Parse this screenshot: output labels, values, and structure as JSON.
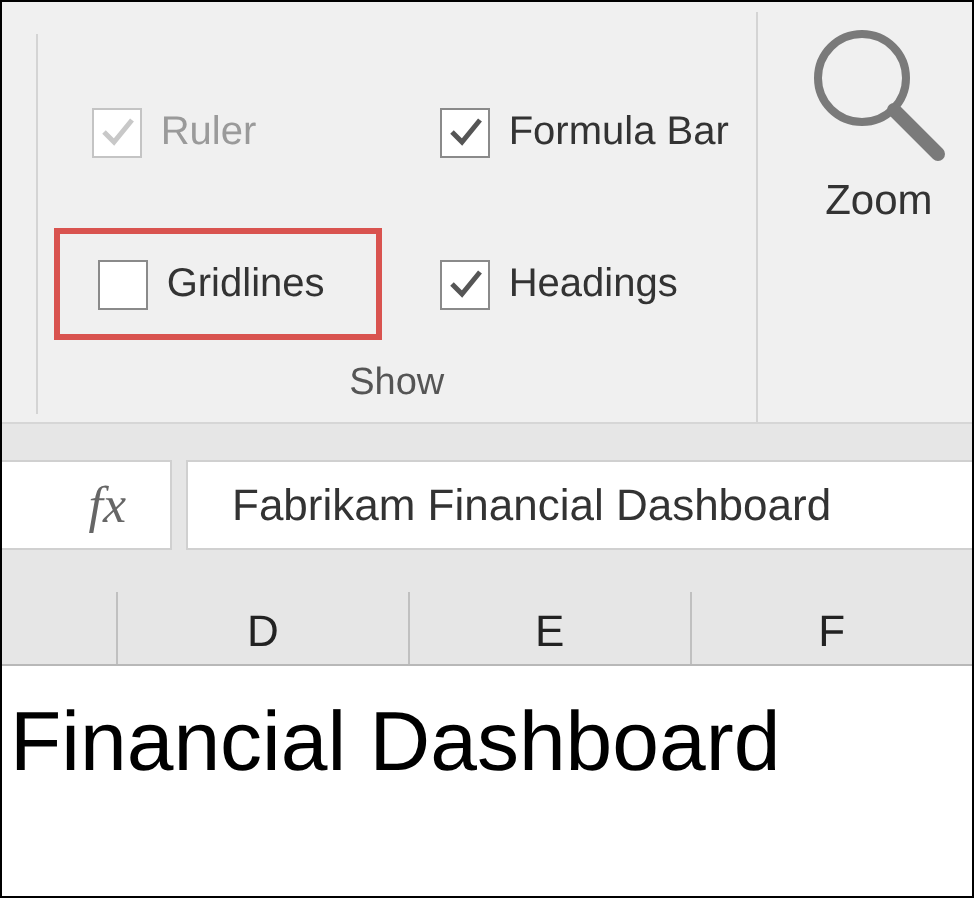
{
  "ribbon": {
    "show_group": {
      "label": "Show",
      "checkboxes": [
        {
          "label": "Ruler",
          "checked": true,
          "disabled": true,
          "highlighted": false
        },
        {
          "label": "Formula Bar",
          "checked": true,
          "disabled": false,
          "highlighted": false
        },
        {
          "label": "Gridlines",
          "checked": false,
          "disabled": false,
          "highlighted": true
        },
        {
          "label": "Headings",
          "checked": true,
          "disabled": false,
          "highlighted": false
        }
      ]
    },
    "zoom_button": {
      "label": "Zoom"
    }
  },
  "formula_bar": {
    "fx": "fx",
    "value": "Fabrikam Financial Dashboard"
  },
  "sheet": {
    "columns": [
      "D",
      "E",
      "F"
    ],
    "cell_text": "Financial Dashboard"
  }
}
